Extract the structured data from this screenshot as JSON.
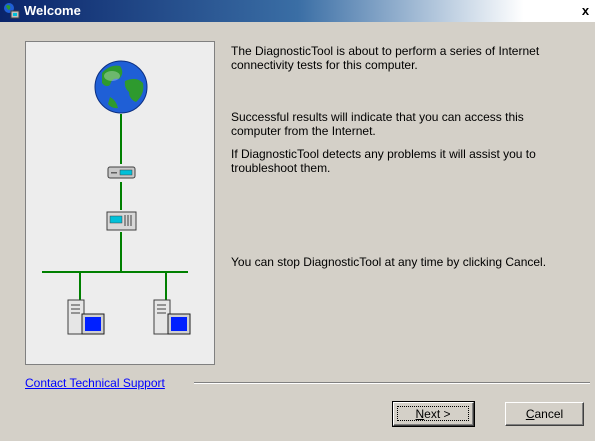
{
  "window": {
    "title": "Welcome",
    "close_label": "x"
  },
  "messages": {
    "intro": "The DiagnosticTool is about to perform a series of Internet\nconnectivity tests for this computer.",
    "success": "Successful results will indicate that you can access this\ncomputer from the Internet.",
    "problems": "If DiagnosticTool detects any problems it will assist you to\ntroubleshoot them.",
    "stop": "You can stop DiagnosticTool at any time by clicking Cancel."
  },
  "support_link": "Contact Technical Support",
  "buttons": {
    "next_mnemonic": "N",
    "next_rest": "ext >",
    "cancel_mnemonic": "C",
    "cancel_rest": "ancel"
  },
  "colors": {
    "network_line": "#008000",
    "globe_ocean": "#1f5fd6",
    "globe_land": "#2e9a2e",
    "device_accent": "#00c0d8",
    "monitor_screen": "#0020ff"
  },
  "icons": [
    "app-icon",
    "globe-icon",
    "modem-icon",
    "router-icon",
    "computer-icon"
  ]
}
